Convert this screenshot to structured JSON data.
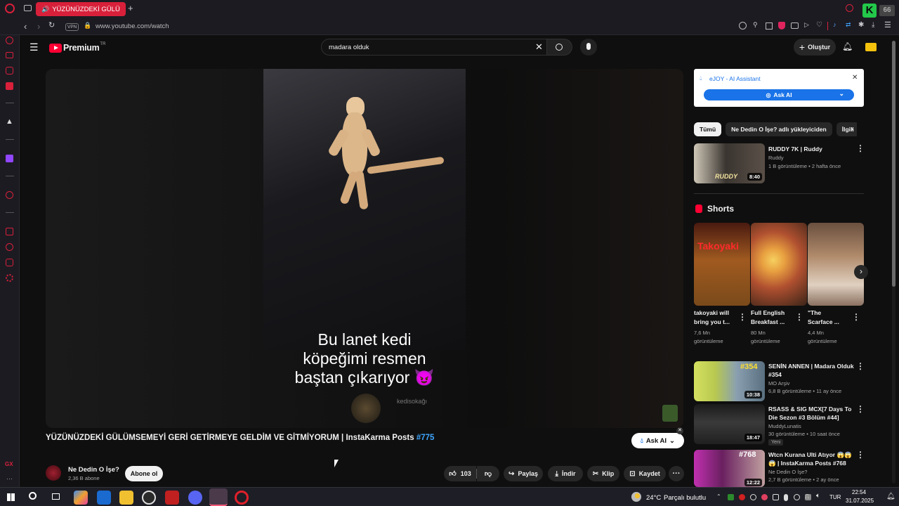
{
  "browser": {
    "tab_title": "YÜZÜNÜZDEKİ GÜLÜ",
    "vpn_label": "VPN",
    "url": "www.youtube.com/watch"
  },
  "youtube": {
    "logo_text": "Premium",
    "logo_sup": "TR",
    "search_value": "madara olduk",
    "create_label": "Oluştur"
  },
  "video": {
    "caption_line1": "Bu lanet kedi",
    "caption_line2": "köpeğimi resmen",
    "caption_line3": "baştan çıkarıyor 😈",
    "watermark": "kedisokağı",
    "title": "YÜZÜNÜZDEKİ GÜLÜMSEMEYİ GERİ GETİRMEYE GELDİM VE GİTMİYORUM | InstaKarma Posts",
    "title_hashtag": "#775",
    "channel_name": "Ne Dedin O İşe?",
    "subscribers": "2,36 B abone",
    "subscribe_label": "Abone ol",
    "like_count": "103",
    "share_label": "Paylaş",
    "download_label": "İndir",
    "clip_label": "Klip",
    "save_label": "Kaydet",
    "ask_ai_label": "Ask AI"
  },
  "ejoy": {
    "title": "eJOY - AI Assistant",
    "button": "Ask AI"
  },
  "chips": [
    "Tümü",
    "Ne Dedin O İşe? adlı yükleyiciden",
    "İlgili"
  ],
  "recommended_top": {
    "title": "RUDDY 7K | Ruddy",
    "channel": "Ruddy",
    "stats": "1 B görüntüleme • 2 hafta önce",
    "duration": "8:40",
    "thumb_text": "RUDDY"
  },
  "shorts": {
    "heading": "Shorts",
    "items": [
      {
        "title1": "takoyaki will",
        "title2": "bring you t...",
        "views1": "7,6 Mn",
        "views2": "görüntüleme",
        "thumb_text": "Takoyaki"
      },
      {
        "title1": "Full English",
        "title2": "Breakfast ...",
        "views1": "80 Mn",
        "views2": "görüntüleme",
        "thumb_text": ""
      },
      {
        "title1": "\"The",
        "title2": "Scarface ...",
        "views1": "4,4 Mn",
        "views2": "görüntüleme",
        "thumb_text": ""
      }
    ]
  },
  "recommended": [
    {
      "title1": "SENİN ANNEN | Madara Olduk",
      "title2": "#354",
      "channel": "MO Arşiv",
      "stats": "6,8 B görüntüleme • 11 ay önce",
      "duration": "10:38",
      "badge": "",
      "thumb_text": "#354"
    },
    {
      "title1": "RSASS & SIG MCX[7 Days To",
      "title2": "Die Sezon #3 Bölüm #44]",
      "channel": "MuddyLunatis",
      "stats": "30 görüntüleme • 10 saat önce",
      "duration": "18:47",
      "badge": "Yeni",
      "thumb_text": ""
    },
    {
      "title1": "Wtcn Kurana Ulti Atıyor 😱😱",
      "title2": "😱 | InstaKarma Posts #768",
      "channel": "Ne Dedin O İşe?",
      "stats": "2,7 B görüntüleme • 2 ay önce",
      "duration": "12:22",
      "badge": "",
      "thumb_text": "#768"
    }
  ],
  "taskbar": {
    "temperature": "24°C",
    "weather": "Parçalı bulutlu",
    "lang": "TUR",
    "time": "22:54",
    "date": "31.07.2025"
  },
  "colors": {
    "opera_red": "#d8203a",
    "youtube_red": "#ff0033",
    "ejoy_blue": "#1a73e8",
    "hashtag_blue": "#3ea6ff"
  }
}
